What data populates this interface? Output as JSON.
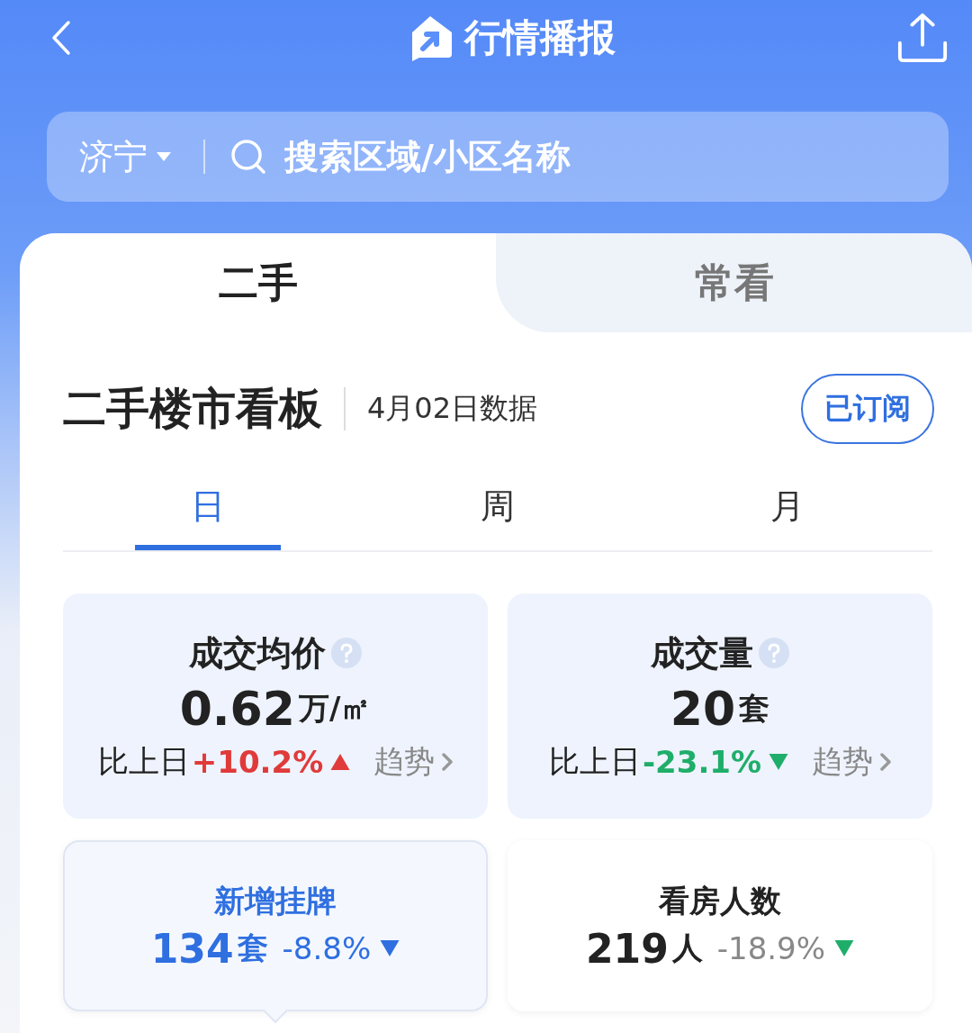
{
  "header": {
    "title": "行情播报"
  },
  "search": {
    "city": "济宁",
    "placeholder": "搜索区域/小区名称"
  },
  "tabs": [
    {
      "label": "二手",
      "selected": true
    },
    {
      "label": "常看",
      "selected": false
    }
  ],
  "board": {
    "title": "二手楼市看板",
    "date": "4月02日数据",
    "subscribe_button": "已订阅"
  },
  "periods": [
    {
      "label": "日",
      "selected": true
    },
    {
      "label": "周",
      "selected": false
    },
    {
      "label": "月",
      "selected": false
    }
  ],
  "main_stats": [
    {
      "label": "成交均价",
      "value": "0.62",
      "unit": "万/㎡",
      "compare_label": "比上日",
      "change": "+10.2%",
      "rising": true,
      "trend": "趋势"
    },
    {
      "label": "成交量",
      "value": "20",
      "unit": "套",
      "compare_label": "比上日",
      "change": "-23.1%",
      "rising": false,
      "trend": "趋势"
    }
  ],
  "sub_stats": [
    {
      "label": "新增挂牌",
      "value": "134",
      "unit": "套",
      "change": "-8.8%",
      "rising": false,
      "selected": true
    },
    {
      "label": "看房人数",
      "value": "219",
      "unit": "人",
      "change": "-18.9%",
      "rising": false,
      "selected": false
    }
  ]
}
